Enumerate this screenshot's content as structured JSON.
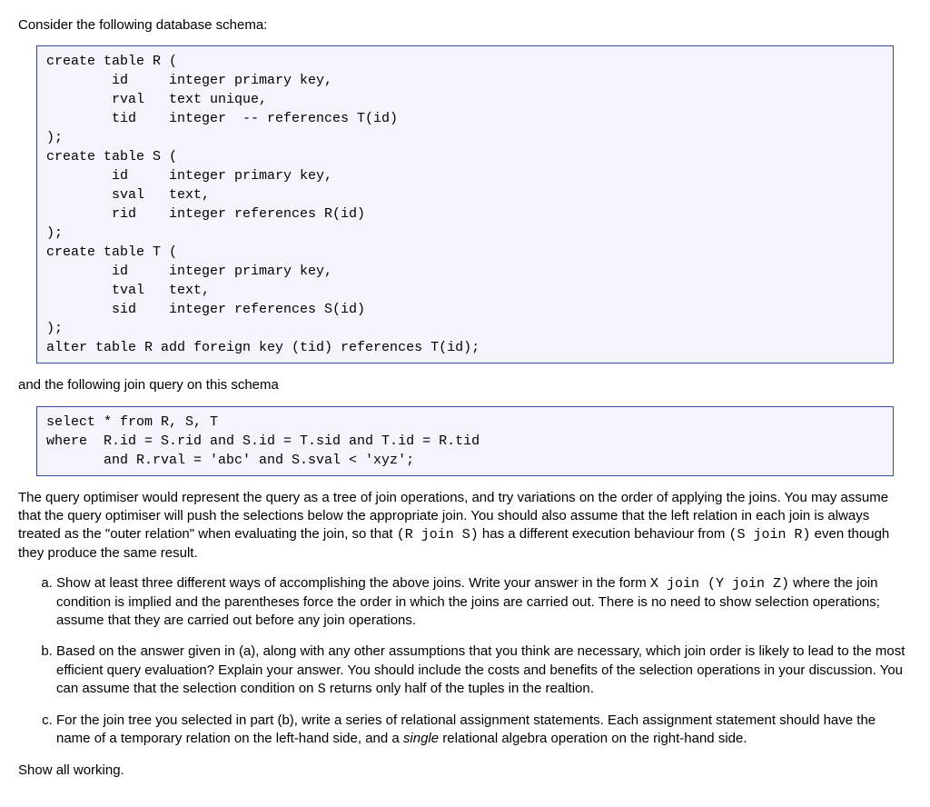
{
  "intro": "Consider the following database schema:",
  "schema_code": "create table R (\n        id     integer primary key,\n        rval   text unique,\n        tid    integer  -- references T(id)\n);\ncreate table S (\n        id     integer primary key,\n        sval   text,\n        rid    integer references R(id)\n);\ncreate table T (\n        id     integer primary key,\n        tval   text,\n        sid    integer references S(id)\n);\nalter table R add foreign key (tid) references T(id);",
  "midtext": "and the following join query on this schema",
  "query_code": "select * from R, S, T\nwhere  R.id = S.rid and S.id = T.sid and T.id = R.tid\n       and R.rval = 'abc' and S.sval < 'xyz';",
  "explain": {
    "before": "The query optimiser would represent the query as a tree of join operations, and try variations on the order of applying the joins. You may assume that the query optimiser will push the selections below the appropriate join. You should also assume that the left relation in each join is always treated as the \"outer relation\" when evaluating the join, so that ",
    "code1": "(R join S)",
    "mid": " has a different execution behaviour from ",
    "code2": "(S join R)",
    "after": " even though they produce the same result."
  },
  "parts": {
    "a": {
      "before": "Show at least three different ways of accomplishing the above joins. Write your answer in the form ",
      "code": "X join (Y join Z)",
      "after": " where the join condition is implied and the parentheses force the order in which the joins are carried out. There is no need to show selection operations; assume that they are carried out before any join operations."
    },
    "b": {
      "before": "Based on the answer given in (a), along with any other assumptions that you think are necessary, which join order is likely to lead to the most efficient query evaluation? Explain your answer. You should include the costs and benefits of the selection operations in your discussion. You can assume that the selection condition on ",
      "code": "S",
      "after": " returns only half of the tuples in the realtion."
    },
    "c": {
      "before": "For the join tree you selected in part (b), write a series of relational assignment statements. Each assignment statement should have the name of a temporary relation on the left-hand side, and a ",
      "italic": "single",
      "after": " relational algebra operation on the right-hand side."
    }
  },
  "closing": "Show all working."
}
